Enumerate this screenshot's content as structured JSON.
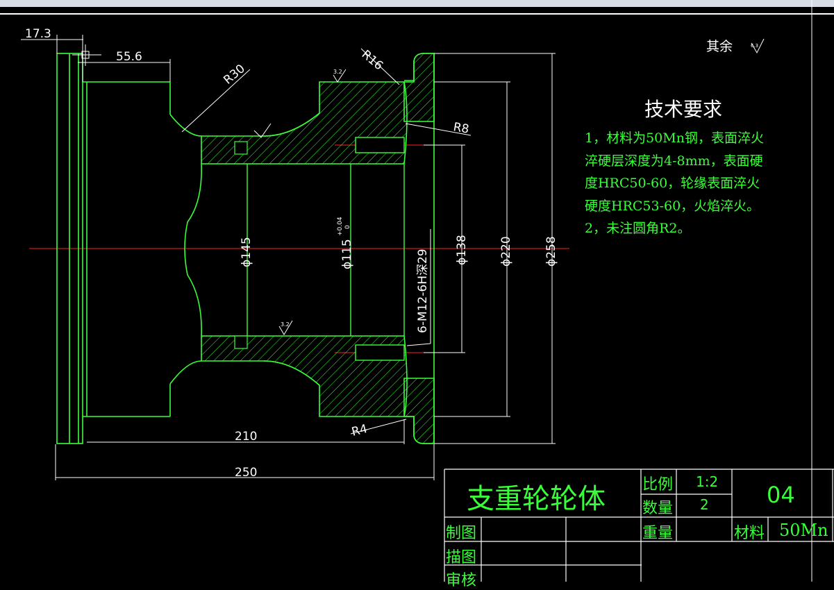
{
  "drawing": {
    "remark": {
      "label": "其余",
      "roughness_value": "6.3"
    },
    "tech_requirements": {
      "title": "技术要求",
      "lines": [
        "1，材料为50Mn钢，表面淬火",
        "淬硬层深度为4-8mm，表面硬",
        "度HRC50-60，轮缘表面淬火",
        "硬度HRC53-60，火焰淬火。",
        "2，未注圆角R2。"
      ]
    },
    "dimensions": {
      "d_17_3": "17.3",
      "d_55_6": "55.6",
      "d_r30": "R30",
      "d_r16": "R16",
      "d_r8": "R8",
      "d_r4": "R4",
      "d_210": "210",
      "d_250": "250",
      "d_145": "ϕ145",
      "d_115": "ϕ115",
      "d_115_tol_upper": "+0.04",
      "d_115_tol_lower": "0",
      "d_thread": "6-M12-6H深29",
      "d_138": "ϕ138",
      "d_220": "ϕ220",
      "d_258": "ϕ258",
      "rough_32_top": "3.2",
      "rough_32_bottom": "3.2"
    },
    "colors": {
      "outline": "#39ff39",
      "dimension": "#ffffff",
      "centerline": "#ff2020",
      "hatch": "#39ff39",
      "background": "#000000"
    }
  },
  "title_block": {
    "part_name": "支重轮轮体",
    "scale_label": "比例",
    "scale_value": "1:2",
    "qty_label": "数量",
    "qty_value": "2",
    "weight_label": "重量",
    "weight_value": "",
    "drawing_no": "04",
    "material_label": "材料",
    "material_value": "50Mn",
    "drawn_by_label": "制图",
    "traced_by_label": "描图",
    "checked_by_label": "审核"
  }
}
